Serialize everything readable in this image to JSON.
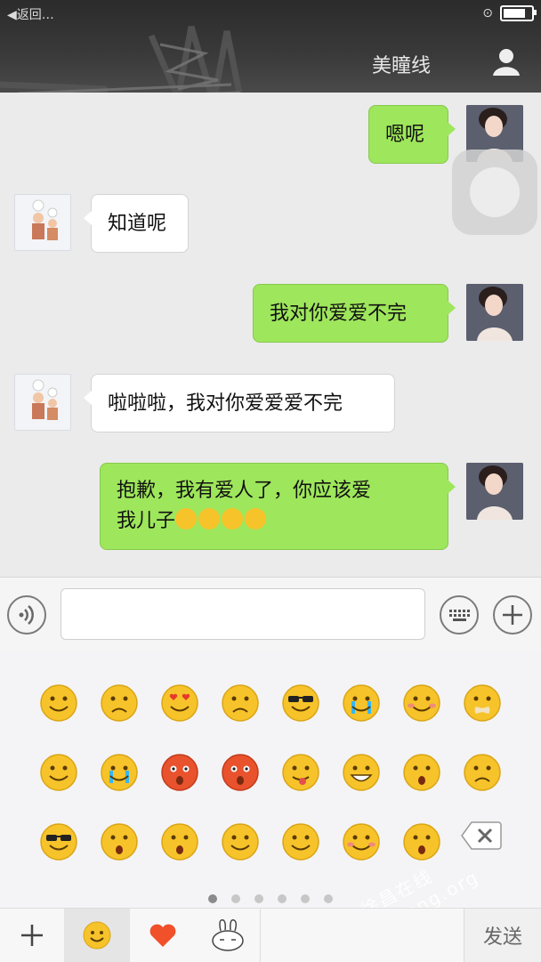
{
  "status_bar": {
    "back_text": "◀返回…",
    "battery": 0.7
  },
  "header": {
    "title": "美瞳线"
  },
  "messages": [
    {
      "from": "me",
      "text": "嗯呢"
    },
    {
      "from": "them",
      "text": "知道呢"
    },
    {
      "from": "me",
      "text": "我对你爱爱不完"
    },
    {
      "from": "them",
      "text": "啦啦啦，我对你爱爱爱不完"
    },
    {
      "from": "me",
      "text_line1": "抱歉，我有爱人了，你应该爱",
      "text_line2": "我儿子"
    }
  ],
  "emoji_rows": [
    [
      "smile",
      "awkward",
      "heart-eyes",
      "angry",
      "cool",
      "crying",
      "shy",
      "shut-mouth"
    ],
    [
      "sleepy",
      "sob",
      "blush-shock",
      "furious",
      "tongue",
      "grin",
      "surprised",
      "sad"
    ],
    [
      "sunglasses-smug",
      "innocent",
      "scream",
      "dizzy",
      "hug",
      "smile-blush",
      "shocked"
    ]
  ],
  "pager": {
    "pages": 6,
    "active": 0
  },
  "tabs": {
    "send_label": "发送"
  },
  "watermark": "徐昌在线 uchang.org",
  "colors": {
    "bubble_me": "#9ee65b",
    "bubble_them": "#ffffff",
    "emoji": "#f7c32a"
  }
}
